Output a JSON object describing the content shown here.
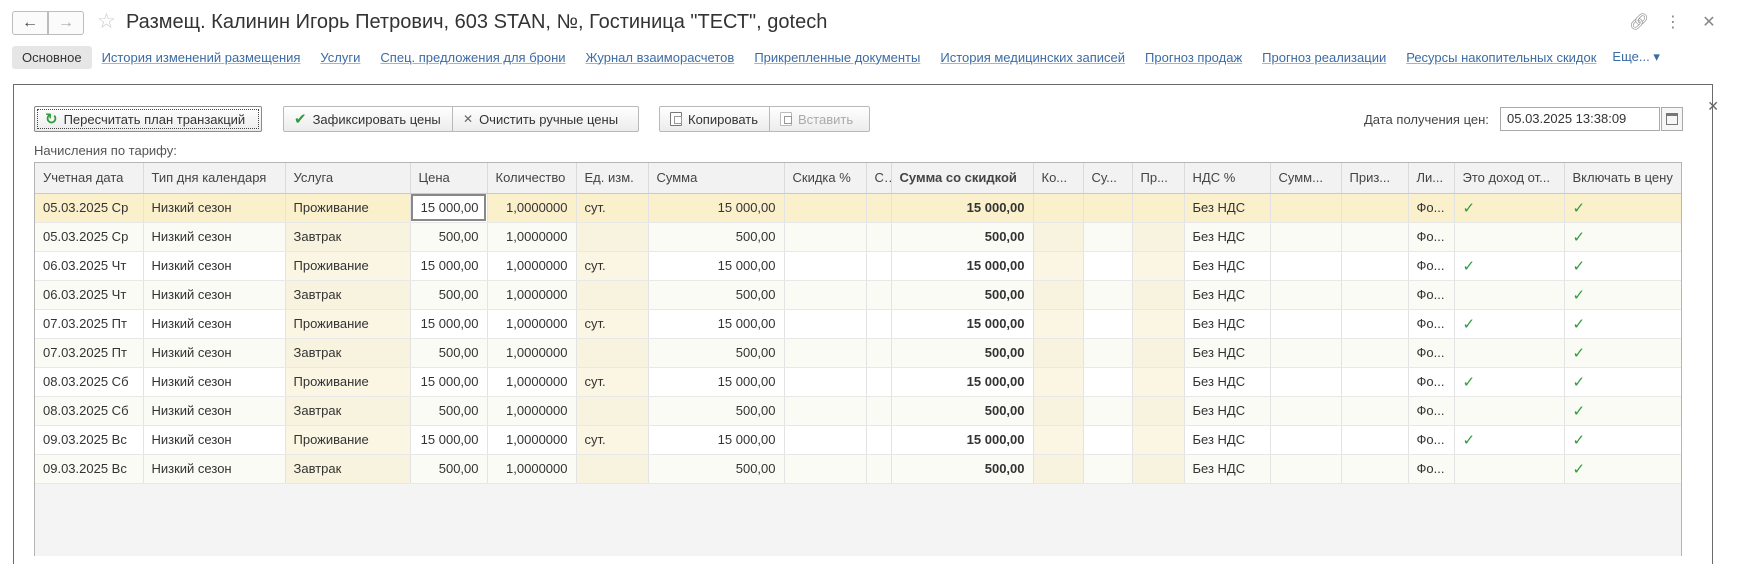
{
  "window": {
    "title": "Размещ. Калинин Игорь Петрович, 603 STAN, №, Гостиница \"ТЕСТ\", gotech"
  },
  "tabs": [
    {
      "label": "Основное",
      "active": true
    },
    {
      "label": "История изменений размещения"
    },
    {
      "label": "Услуги"
    },
    {
      "label": "Спец. предложения для брони"
    },
    {
      "label": "Журнал взаиморасчетов"
    },
    {
      "label": "Прикрепленные документы"
    },
    {
      "label": "История медицинских записей"
    },
    {
      "label": "Прогноз продаж"
    },
    {
      "label": "Прогноз реализации"
    },
    {
      "label": "Ресурсы накопительных скидок"
    }
  ],
  "more_label": "Еще...",
  "toolbar": {
    "recalc_label": "Пересчитать план транзакций",
    "fix_label": "Зафиксировать цены",
    "clear_label": "Очистить ручные цены",
    "copy_label": "Копировать",
    "paste_label": "Вставить",
    "price_date_label": "Дата получения цен:",
    "price_date_value": "05.03.2025 13:38:09"
  },
  "section_label": "Начисления по тарифу:",
  "table": {
    "columns": [
      "Учетная дата",
      "Тип дня календаря",
      "Услуга",
      "Цена",
      "Количество",
      "Ед. изм.",
      "Сумма",
      "Скидка %",
      "С",
      "Сумма со скидкой",
      "Ко...",
      "Су...",
      "Пр...",
      "НДС %",
      "Сумм...",
      "Приз...",
      "Ли...",
      "Это доход от...",
      "Включать в цену"
    ],
    "rows": [
      [
        "05.03.2025 Ср",
        "Низкий сезон",
        "Проживание",
        "15 000,00",
        "1,0000000",
        "сут.",
        "15 000,00",
        "",
        "",
        "15 000,00",
        "",
        "",
        "",
        "Без НДС",
        "",
        "",
        "Фо...",
        "✓",
        "✓"
      ],
      [
        "05.03.2025 Ср",
        "Низкий сезон",
        "Завтрак",
        "500,00",
        "1,0000000",
        "",
        "500,00",
        "",
        "",
        "500,00",
        "",
        "",
        "",
        "Без НДС",
        "",
        "",
        "Фо...",
        "",
        "✓"
      ],
      [
        "06.03.2025 Чт",
        "Низкий сезон",
        "Проживание",
        "15 000,00",
        "1,0000000",
        "сут.",
        "15 000,00",
        "",
        "",
        "15 000,00",
        "",
        "",
        "",
        "Без НДС",
        "",
        "",
        "Фо...",
        "✓",
        "✓"
      ],
      [
        "06.03.2025 Чт",
        "Низкий сезон",
        "Завтрак",
        "500,00",
        "1,0000000",
        "",
        "500,00",
        "",
        "",
        "500,00",
        "",
        "",
        "",
        "Без НДС",
        "",
        "",
        "Фо...",
        "",
        "✓"
      ],
      [
        "07.03.2025 Пт",
        "Низкий сезон",
        "Проживание",
        "15 000,00",
        "1,0000000",
        "сут.",
        "15 000,00",
        "",
        "",
        "15 000,00",
        "",
        "",
        "",
        "Без НДС",
        "",
        "",
        "Фо...",
        "✓",
        "✓"
      ],
      [
        "07.03.2025 Пт",
        "Низкий сезон",
        "Завтрак",
        "500,00",
        "1,0000000",
        "",
        "500,00",
        "",
        "",
        "500,00",
        "",
        "",
        "",
        "Без НДС",
        "",
        "",
        "Фо...",
        "",
        "✓"
      ],
      [
        "08.03.2025 Сб",
        "Низкий сезон",
        "Проживание",
        "15 000,00",
        "1,0000000",
        "сут.",
        "15 000,00",
        "",
        "",
        "15 000,00",
        "",
        "",
        "",
        "Без НДС",
        "",
        "",
        "Фо...",
        "✓",
        "✓"
      ],
      [
        "08.03.2025 Сб",
        "Низкий сезон",
        "Завтрак",
        "500,00",
        "1,0000000",
        "",
        "500,00",
        "",
        "",
        "500,00",
        "",
        "",
        "",
        "Без НДС",
        "",
        "",
        "Фо...",
        "",
        "✓"
      ],
      [
        "09.03.2025 Вс",
        "Низкий сезон",
        "Проживание",
        "15 000,00",
        "1,0000000",
        "сут.",
        "15 000,00",
        "",
        "",
        "15 000,00",
        "",
        "",
        "",
        "Без НДС",
        "",
        "",
        "Фо...",
        "✓",
        "✓"
      ],
      [
        "09.03.2025 Вс",
        "Низкий сезон",
        "Завтрак",
        "500,00",
        "1,0000000",
        "",
        "500,00",
        "",
        "",
        "500,00",
        "",
        "",
        "",
        "Без НДС",
        "",
        "",
        "Фо...",
        "",
        "✓"
      ]
    ]
  },
  "colors": {
    "accent_link": "#3b6ba5",
    "check_green": "#2e9d3a",
    "selected_row": "#fbf0cc"
  },
  "icons": {
    "back": "arrow-left-icon",
    "forward": "arrow-right-icon",
    "favorite": "star-icon",
    "link": "link-icon",
    "menu": "more-vertical-icon",
    "close": "close-icon",
    "recalc": "refresh-icon",
    "fix": "checkmark-icon",
    "clear": "cross-icon",
    "copy": "copy-icon",
    "paste": "paste-icon",
    "calendar": "calendar-icon"
  }
}
